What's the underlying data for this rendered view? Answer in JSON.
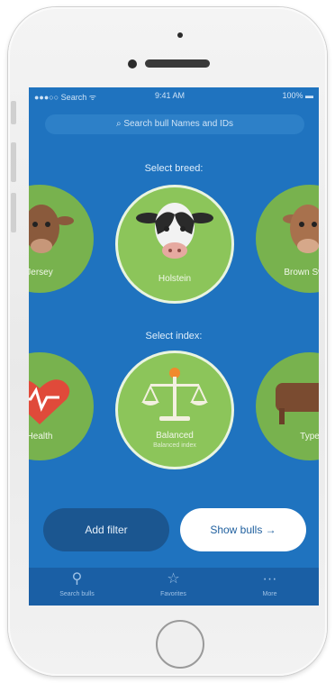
{
  "status_bar": {
    "carrier": "●●●○○ Search ᯤ",
    "time": "9:41 AM",
    "battery": "100% ▬"
  },
  "search": {
    "placeholder": "Search bull Names and IDs"
  },
  "breed": {
    "label": "Select breed:",
    "items": [
      {
        "name": "Jersey",
        "selected": false
      },
      {
        "name": "Holstein",
        "selected": true
      },
      {
        "name": "Brown Swiss",
        "selected": false
      }
    ]
  },
  "index": {
    "label": "Select index:",
    "items": [
      {
        "name": "Health",
        "sub": "",
        "selected": false
      },
      {
        "name": "Balanced",
        "sub": "Balanced index",
        "selected": true
      },
      {
        "name": "Type",
        "sub": "",
        "selected": false
      }
    ]
  },
  "buttons": {
    "add_filter": "Add filter",
    "show_bulls": "Show bulls →"
  },
  "tabs": [
    {
      "icon": "search-icon",
      "label": "Search bulls"
    },
    {
      "icon": "star-icon",
      "label": "Favorites"
    },
    {
      "icon": "menu-icon",
      "label": "More"
    }
  ],
  "colors": {
    "screen_bg": "#1f73bf",
    "circle_green": "#8cc55a",
    "tabbar": "#1a5fa5"
  }
}
